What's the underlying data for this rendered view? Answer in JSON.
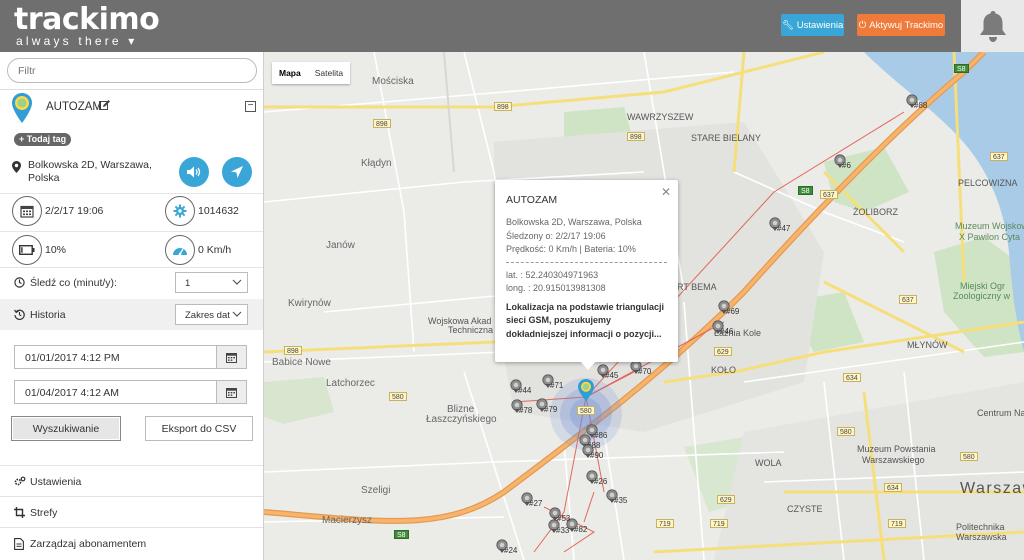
{
  "header": {
    "logo_main": "trackimo",
    "logo_sub": "always there",
    "settings_label": "Ustawienia",
    "activate_label": "Aktywuj Trackimo"
  },
  "sidebar": {
    "filter_placeholder": "Filtr",
    "device_name": "AUTOZAM",
    "add_tag_label": "+ Todaj tag",
    "address": "Bolkowska 2D, Warszawa, Polska",
    "date": "2/2/17 19:06",
    "device_id": "1014632",
    "battery": "10%",
    "speed": "0 Km/h",
    "track_label": "Śledź co (minut/y):",
    "track_value": "1",
    "history_label": "Historia",
    "history_value": "Zakres dat",
    "date_from": "01/01/2017 4:12 PM",
    "date_to": "01/04/2017 4:12 AM",
    "search_label": "Wyszukiwanie",
    "export_label": "Eksport do CSV",
    "menu": [
      {
        "label": "Ustawienia",
        "icon": "gears-icon"
      },
      {
        "label": "Strefy",
        "icon": "crop-icon"
      },
      {
        "label": "Zarządzaj abonamentem",
        "icon": "document-icon"
      }
    ]
  },
  "map": {
    "type_map": "Mapa",
    "type_satellite": "Satelita",
    "labels": {
      "moscisko": "Mościska",
      "wawrzyszew": "WAWRZYSZEW",
      "stare_bielany": "STARE BIELANY",
      "kladyn": "Kłądyn",
      "janow": "Janów",
      "zoliborz": "ŻOLIBORZ",
      "pelcowizna": "PELCOWIZNA",
      "muzeum_wojskowe": "Muzeum Wojskowe",
      "muzeum_wojskowe_2": "X Pawilon Cyta",
      "kwirynow": "Kwirynów",
      "wojskowa": "Wojskowa Akad",
      "wojskowa_2": "Techniczna",
      "fort_bema": "RT BEMA",
      "babice": "Babice Nowe",
      "latchorzec": "Latchorzec",
      "kolo": "KOŁO",
      "mlynow": "MŁYNÓW",
      "zoo": "Miejski Ogr",
      "zoo_2": "Zoologiczny w",
      "blizne": "Blizne",
      "blizne_2": "Łaszczyńskiego",
      "wola": "WOLA",
      "muzeum_powstania": "Muzeum Powstania",
      "muzeum_powstania_2": "Warszawskiego",
      "centrum": "Centrum Nauk",
      "szeligi": "Szeligi",
      "warszawa": "Warszaw",
      "maciersz": "Macierzysz",
      "czyste": "CZYSTE",
      "politechnika": "Politechnika",
      "politechnika_2": "Warszawska",
      "laznia_kole": "Łaźnia Kole"
    },
    "roads": [
      "S8",
      "898",
      "898",
      "898",
      "898",
      "580",
      "637",
      "637",
      "637",
      "629",
      "634",
      "580",
      "580",
      "580",
      "719",
      "719",
      "719",
      "629",
      "634",
      "S8",
      "S8"
    ],
    "markers": [
      "#88",
      "#6",
      "#47",
      "#69",
      "#46",
      "#45",
      "#70",
      "#71",
      "#44",
      "#78",
      "#79",
      "#86",
      "#88",
      "#90",
      "#35",
      "#33",
      "#82",
      "#26",
      "#27",
      "#24",
      "#53"
    ],
    "popup": {
      "title": "AUTOZAM",
      "address": "Bolkowska 2D, Warszawa, Polska",
      "tracked": "Śledzony o: 2/2/17 19:06",
      "speed": "Prędkość: 0 Km/h | Bateria: 10%",
      "lat": "lat. : 52.2403049719​63",
      "lng": "long. : 20.915013981308",
      "note": "Lokalizacja na podstawie triangulacji sieci GSM, poszukujemy dokładniejszej informacji o pozycji..."
    }
  },
  "colors": {
    "header_bg": "#6f6f6f",
    "accent_blue": "#3aa6d8",
    "accent_orange": "#f07a3a",
    "highway": "#f2a25a"
  }
}
